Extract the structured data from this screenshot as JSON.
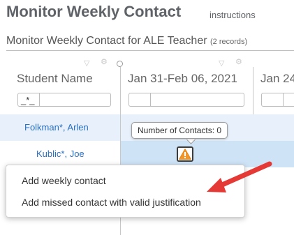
{
  "header": {
    "title": "Monitor Weekly Contact",
    "instructions_label": "instructions"
  },
  "section": {
    "title": "Monitor Weekly Contact for ALE Teacher",
    "record_count": "(2 records)"
  },
  "grid": {
    "columns": [
      {
        "label": "Student Name",
        "filter_value": "_*_"
      },
      {
        "label": "Jan 31-Feb 06, 2021",
        "filter_value": ""
      },
      {
        "label": "Jan 24",
        "filter_value": ""
      }
    ],
    "rows": [
      {
        "student": "Folkman*, Arlen"
      },
      {
        "student": "Kublic*, Joe"
      }
    ]
  },
  "tooltip": {
    "text": "Number of Contacts: 0"
  },
  "context_menu": {
    "items": [
      {
        "label": "Add weekly contact"
      },
      {
        "label": "Add missed contact with valid justification"
      }
    ]
  },
  "colors": {
    "accent_link": "#2a6fc0",
    "warning": "#f0962a",
    "arrow": "#e53935",
    "selected_row": "#cfe3f7"
  },
  "icons": [
    "filter-icon",
    "gear-icon",
    "warning-icon",
    "arrow-annotation"
  ]
}
